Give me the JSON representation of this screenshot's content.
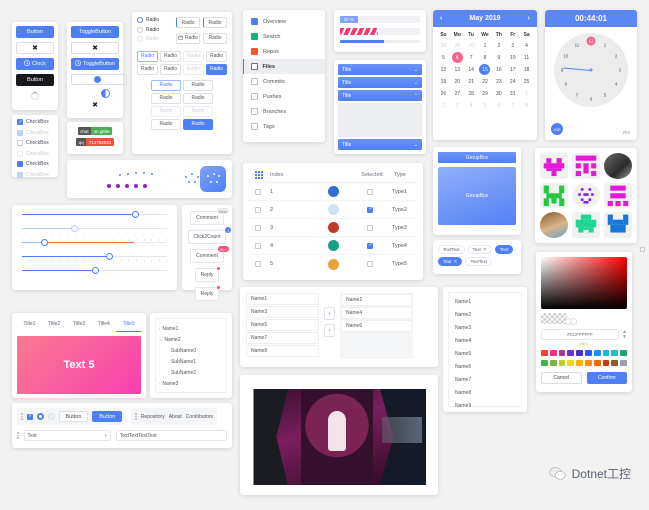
{
  "buttons_panel": {
    "name": "buttons",
    "primary_label": "Button",
    "icon_label": "✖",
    "clock_label": "Clock",
    "dark_label": "Button",
    "clock_icon": "clock-icon",
    "spinner_icon": "loading-spinner-icon"
  },
  "checkboxes": {
    "items": [
      {
        "label": "CheckBox",
        "state": "checked"
      },
      {
        "label": "CheckBox",
        "state": "checked-disabled"
      },
      {
        "label": "CheckBox",
        "state": "unchecked"
      },
      {
        "label": "CheckBox",
        "state": "unchecked-disabled"
      },
      {
        "label": "CheckBox",
        "state": "solid"
      },
      {
        "label": "CheckBox",
        "state": "solid-disabled"
      }
    ]
  },
  "toggle_panel": {
    "toggle_label": "ToggleButton",
    "icon_label": "✖",
    "toggle_clock_label": "ToggleButton",
    "close_label": "✖",
    "clock_icon": "clock-icon"
  },
  "shield_badges": [
    {
      "key": "chat",
      "value": "on gitter",
      "color": "#4cb050"
    },
    {
      "key": "qq",
      "value": "714794041",
      "color": "#e8543f"
    }
  ],
  "radio_panel": {
    "vertical": [
      {
        "label": "Radio",
        "state": "on"
      },
      {
        "label": "Radio",
        "state": "off"
      },
      {
        "label": "Radio",
        "state": "disabled"
      }
    ],
    "top_right": [
      {
        "label": "Radio",
        "state": "normal"
      },
      {
        "label": "Radio",
        "state": "accent"
      },
      {
        "label": "Radio",
        "state": "calendar-icon"
      },
      {
        "label": "Radio",
        "state": "normal"
      }
    ],
    "grid_row1": [
      {
        "label": "Radio",
        "state": "selected"
      },
      {
        "label": "Radio",
        "state": "normal"
      },
      {
        "label": "Radio",
        "state": "disabled"
      },
      {
        "label": "Radio",
        "state": "normal"
      }
    ],
    "grid_row2": [
      {
        "label": "Radio",
        "state": "normal"
      },
      {
        "label": "Radio",
        "state": "normal"
      },
      {
        "label": "Radio",
        "state": "disabled"
      },
      {
        "label": "Radio",
        "state": "filled"
      }
    ],
    "mini_grid": [
      {
        "label": "Radio",
        "state": "selected"
      },
      {
        "label": "Radio",
        "state": "normal"
      },
      {
        "label": "Radio",
        "state": "normal"
      },
      {
        "label": "Radio",
        "state": "normal"
      },
      {
        "label": "Radio",
        "state": "disabled"
      },
      {
        "label": "Radio",
        "state": "disabled"
      },
      {
        "label": "Radio",
        "state": "normal"
      },
      {
        "label": "Radio",
        "state": "filled"
      }
    ]
  },
  "menu": {
    "items": [
      {
        "label": "Overview",
        "icon": "overview-icon",
        "color": "#4f7ff4",
        "active": false
      },
      {
        "label": "Search",
        "icon": "search-icon",
        "color": "#14b37d",
        "active": false
      },
      {
        "label": "Repos",
        "icon": "repos-icon",
        "color": "#f05a28",
        "active": false
      },
      {
        "label": "Files",
        "icon": "files-icon",
        "color": "#6b7280",
        "active": true
      },
      {
        "label": "Commits",
        "icon": "commits-icon",
        "color": "#9aa0ab",
        "active": false
      },
      {
        "label": "Pushes",
        "icon": "pushes-icon",
        "color": "#9aa0ab",
        "active": false
      },
      {
        "label": "Branches",
        "icon": "branches-icon",
        "color": "#9aa0ab",
        "active": false
      },
      {
        "label": "Tags",
        "icon": "tags-icon",
        "color": "#9aa0ab",
        "active": false
      }
    ]
  },
  "progress": {
    "labeled_value": "20 %",
    "labeled_percent": 20,
    "striped_percent": 48,
    "thin_percent": 55,
    "striped_color": "#f5376f",
    "thin_color": "#4f7ff4"
  },
  "expander": {
    "items": [
      {
        "title": "Title",
        "expanded": false
      },
      {
        "title": "Title",
        "expanded": false
      },
      {
        "title": "Title",
        "expanded": true
      },
      {
        "title": "Title",
        "expanded": false
      }
    ],
    "chevron_down": "⌄",
    "chevron_up": "⌃"
  },
  "calendar": {
    "title": "May 2019",
    "prev_icon": "‹",
    "next_icon": "›",
    "dow": [
      "Su",
      "Mo",
      "Tu",
      "We",
      "Th",
      "Fr",
      "Sa"
    ],
    "weeks": [
      [
        {
          "d": "28",
          "mute": true
        },
        {
          "d": "29",
          "mute": true
        },
        {
          "d": "30",
          "mute": true
        },
        {
          "d": "1"
        },
        {
          "d": "2"
        },
        {
          "d": "3"
        },
        {
          "d": "4"
        }
      ],
      [
        {
          "d": "5"
        },
        {
          "d": "6",
          "hl": "pink"
        },
        {
          "d": "7"
        },
        {
          "d": "8"
        },
        {
          "d": "9"
        },
        {
          "d": "10"
        },
        {
          "d": "11"
        }
      ],
      [
        {
          "d": "12"
        },
        {
          "d": "13"
        },
        {
          "d": "14"
        },
        {
          "d": "15",
          "hl": "blue"
        },
        {
          "d": "16"
        },
        {
          "d": "17"
        },
        {
          "d": "18"
        }
      ],
      [
        {
          "d": "19"
        },
        {
          "d": "20"
        },
        {
          "d": "21"
        },
        {
          "d": "22"
        },
        {
          "d": "23"
        },
        {
          "d": "24"
        },
        {
          "d": "25"
        }
      ],
      [
        {
          "d": "26"
        },
        {
          "d": "27"
        },
        {
          "d": "28"
        },
        {
          "d": "29"
        },
        {
          "d": "30"
        },
        {
          "d": "31"
        },
        {
          "d": "1",
          "mute": true
        }
      ],
      [
        {
          "d": "2",
          "mute": true
        },
        {
          "d": "3",
          "mute": true
        },
        {
          "d": "4",
          "mute": true
        },
        {
          "d": "5",
          "mute": true
        },
        {
          "d": "6",
          "mute": true
        },
        {
          "d": "7",
          "mute": true
        },
        {
          "d": "8",
          "mute": true
        }
      ]
    ]
  },
  "clock": {
    "time": "00:44:01",
    "hours": [
      "12",
      "1",
      "2",
      "3",
      "4",
      "5",
      "6",
      "7",
      "8",
      "9",
      "10",
      "11"
    ],
    "highlight_hour": "12",
    "am_label": "Am",
    "pm_label": "Pm"
  },
  "sliders": [
    {
      "value": 78,
      "color": "#4f7ff4",
      "ticks": false
    },
    {
      "value": 36,
      "color": "#b9cdfb",
      "ticks": false
    },
    {
      "value": 15,
      "color": "#f4694a",
      "ticks": true
    },
    {
      "value": 60,
      "color": "#4f7ff4",
      "ticks": true
    },
    {
      "value": 50,
      "color": "#4f7ff4",
      "ticks": true
    }
  ],
  "badge_buttons": [
    {
      "label": "Comment",
      "badge": "New",
      "badge_type": "gray"
    },
    {
      "label": "Click2Count",
      "badge": "1",
      "badge_type": "blue"
    },
    {
      "label": "Comment",
      "badge": "99+",
      "badge_type": "pink"
    },
    {
      "label": "Reply",
      "badge": "",
      "badge_type": "dot"
    },
    {
      "label": "Reply",
      "badge": "",
      "badge_type": "dot"
    }
  ],
  "table": {
    "grip_icon": "grid-grip-icon",
    "columns": [
      "Index",
      "Selected",
      "Type"
    ],
    "rows": [
      {
        "index": "1",
        "selected": false,
        "type": "Type1",
        "avatar": "#2f6fd0"
      },
      {
        "index": "2",
        "selected": true,
        "type": "Type2",
        "avatar": "#cfe3f2"
      },
      {
        "index": "3",
        "selected": false,
        "type": "Type3",
        "avatar": "#c0392b"
      },
      {
        "index": "4",
        "selected": true,
        "type": "Type4",
        "avatar": "#16a085"
      },
      {
        "index": "5",
        "selected": false,
        "type": "Type5",
        "avatar": "#e8a33d"
      }
    ]
  },
  "groupbox": {
    "header_label": "GroupBox",
    "body_label": "GroupBox"
  },
  "chips": [
    {
      "label": "TextText",
      "style": "plain",
      "closable": false
    },
    {
      "label": "Text",
      "style": "plain",
      "closable": true
    },
    {
      "label": "Text",
      "style": "blue",
      "closable": false
    },
    {
      "label": "Text",
      "style": "blue",
      "closable": true
    },
    {
      "label": "TextText",
      "style": "plain",
      "closable": false
    }
  ],
  "avatars": [
    {
      "name": "pixel-heart-avatar",
      "shape": "square"
    },
    {
      "name": "pixel-blocks-avatar",
      "shape": "square"
    },
    {
      "name": "photo-portrait-avatar",
      "shape": "round"
    },
    {
      "name": "pixel-green-avatar",
      "shape": "square"
    },
    {
      "name": "pixel-dots-avatar",
      "shape": "round"
    },
    {
      "name": "pixel-magenta-avatar",
      "shape": "square"
    },
    {
      "name": "photo-landscape-avatar",
      "shape": "round"
    },
    {
      "name": "pixel-invader-avatar",
      "shape": "square"
    },
    {
      "name": "pixel-blue-avatar",
      "shape": "square"
    }
  ],
  "color_picker": {
    "hex_value": "#CCFFFFFF",
    "hex_label": "HEX",
    "cancel_label": "Cancel",
    "confirm_label": "Confirm",
    "swatches_row1": [
      "#f04134",
      "#f5317f",
      "#b5339b",
      "#722ed1",
      "#4334c4",
      "#2f54eb",
      "#1890ff",
      "#13b9d9",
      "#13c2c2",
      "#21a179"
    ],
    "swatches_row2": [
      "#3cb44b",
      "#7cb342",
      "#c0ca33",
      "#fbd200",
      "#fab005",
      "#fa8c16",
      "#f56a00",
      "#d4380d",
      "#8b5a2b",
      "#9aa0ab"
    ]
  },
  "tabs": {
    "items": [
      {
        "label": "Title1",
        "active": false
      },
      {
        "label": "Title2",
        "active": false
      },
      {
        "label": "Title3",
        "active": false
      },
      {
        "label": "Title4",
        "active": false
      },
      {
        "label": "Title5",
        "active": true
      }
    ],
    "panel_text": "Text 5"
  },
  "tree": {
    "nodes": [
      {
        "label": "Name1",
        "level": 0,
        "marker": "›"
      },
      {
        "label": "Name2",
        "level": 0,
        "marker": "⌄"
      },
      {
        "label": "SubName0",
        "level": 1,
        "marker": ""
      },
      {
        "label": "SubName1",
        "level": 1,
        "marker": ""
      },
      {
        "label": "SubName2",
        "level": 1,
        "marker": ""
      },
      {
        "label": "Name3",
        "level": 0,
        "marker": "›"
      }
    ]
  },
  "toolbar": {
    "button1_label": "Button",
    "button2_label": "Button",
    "menu_items": [
      "Repository",
      "About",
      "Contributors"
    ],
    "combo_value": "Text",
    "textbox_value": "TextTextTextText",
    "chevron_icon": "chevron-down-icon",
    "grip_icon": "drag-grip-icon"
  },
  "transfer": {
    "left_items": [
      "Name1",
      "Name3",
      "Name5",
      "Name7",
      "Name8"
    ],
    "right_items": [
      "Name2",
      "Name4",
      "Name6"
    ],
    "to_left_icon": "‹",
    "to_right_icon": "›"
  },
  "long_list": {
    "items": [
      "Name1",
      "Name2",
      "Name3",
      "Name4",
      "Name5",
      "Name6",
      "Name7",
      "Name8",
      "Name9"
    ]
  },
  "image_card": {
    "name": "album-cover-image"
  },
  "watermark": {
    "text": "Dotnet工控",
    "icon": "wechat-icon"
  },
  "colors": {
    "accent": "#4f7ff4",
    "pink": "#f4648a",
    "page_bg": "#f2f2f2"
  }
}
